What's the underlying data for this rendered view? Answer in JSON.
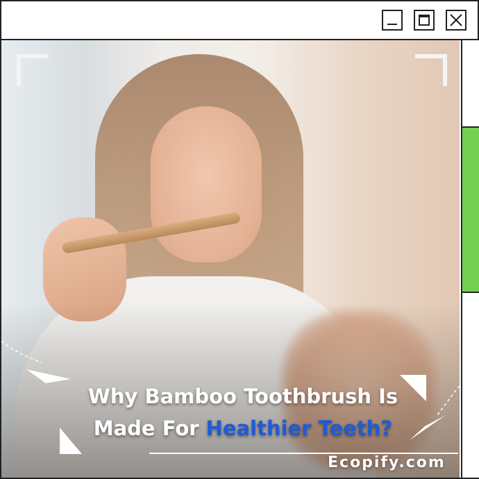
{
  "window": {
    "controls": {
      "minimize_icon": "minimize-icon",
      "maximize_icon": "maximize-icon",
      "close_icon": "close-icon"
    }
  },
  "image": {
    "subject": "Woman brushing teeth with bamboo toothbrush"
  },
  "headline": {
    "line1": "Why Bamboo Toothbrush Is",
    "line2_plain": "Made For ",
    "line2_accent": "Healthier Teeth?"
  },
  "brand": {
    "name": "Ecopify.com"
  },
  "colors": {
    "accent": "#1f5bd6",
    "scroll_thumb": "#74d051",
    "border": "#222222"
  }
}
